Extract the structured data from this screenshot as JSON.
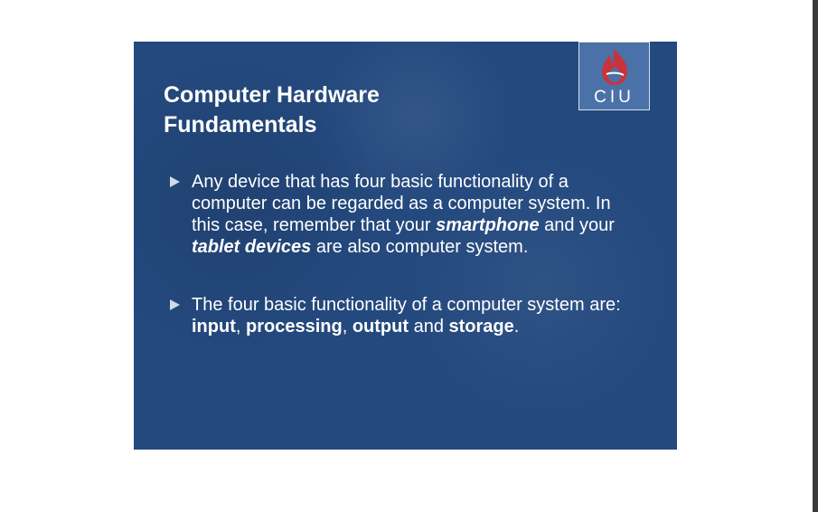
{
  "slide": {
    "title": "Computer Hardware Fundamentals",
    "logo": {
      "text": "CIU",
      "icon": "flame-icon",
      "box_color": "#4a72a8",
      "flame_color": "#c8343c"
    },
    "background_color": "#24497e",
    "bullets": [
      {
        "segments": [
          "Any device that has four basic functionality of a computer can be regarded as a computer system. In this case, remember that your ",
          "smartphone",
          " and your ",
          "tablet devices",
          " are also computer system."
        ]
      },
      {
        "segments": [
          "The four basic functionality of a computer system are:  ",
          "input",
          ", ",
          "processing",
          ", ",
          "output",
          " and ",
          "storage",
          "."
        ]
      }
    ]
  }
}
